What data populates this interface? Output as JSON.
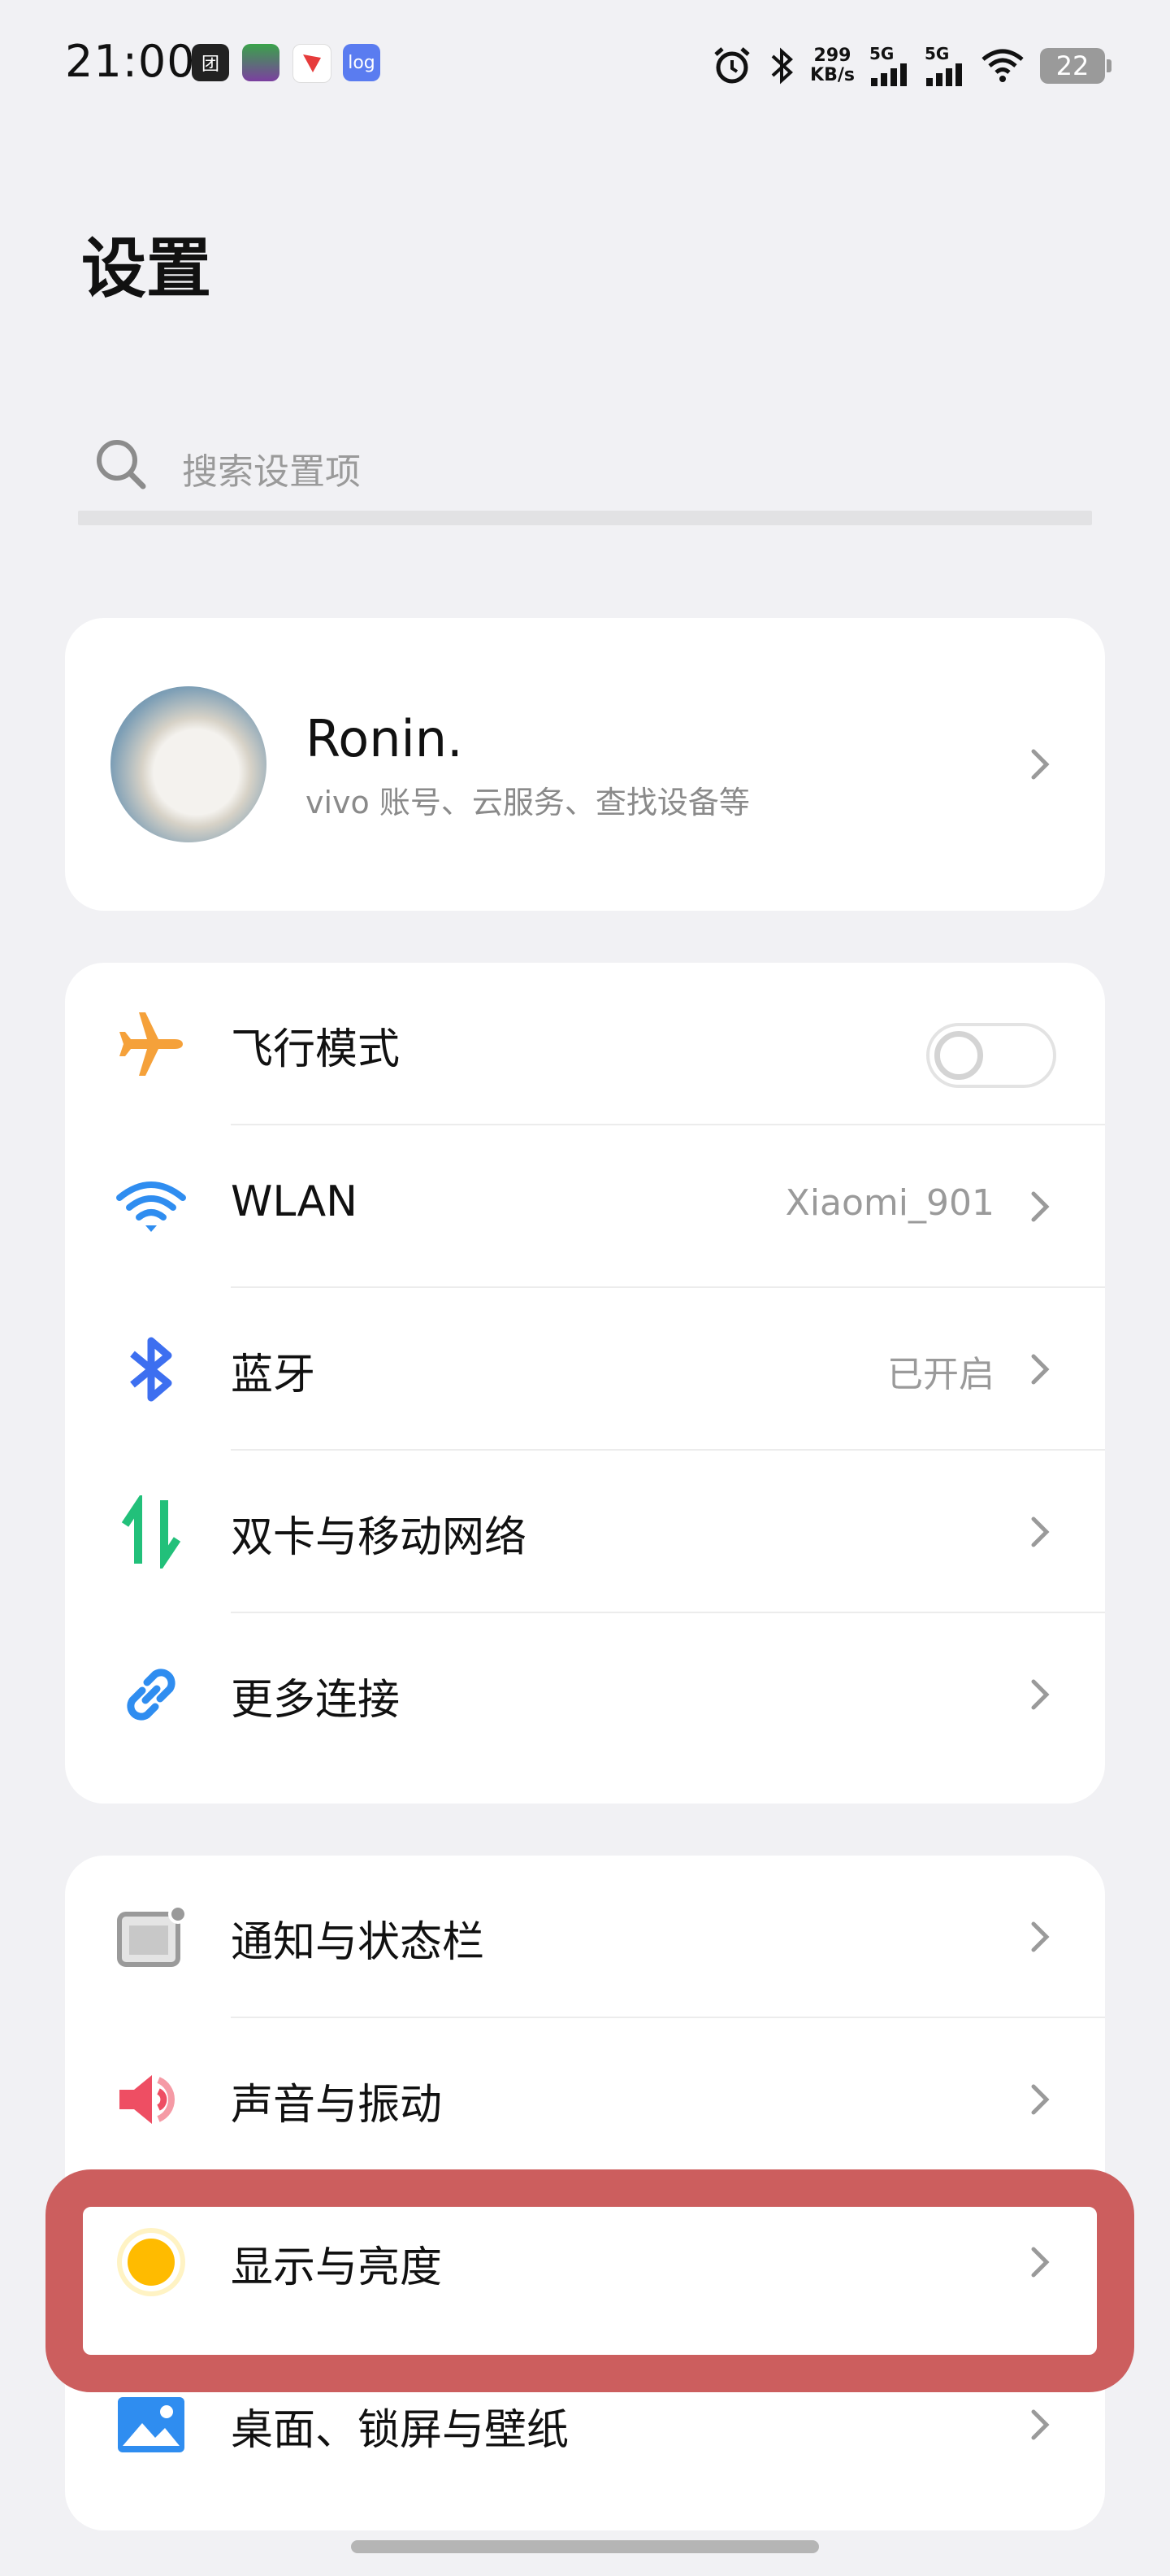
{
  "status_bar": {
    "time": "21:00",
    "apps": [
      "团",
      "",
      "",
      "log"
    ],
    "net_speed_value": "299",
    "net_speed_unit": "KB/s",
    "sim1_label": "5G",
    "sim2_label": "5G",
    "battery": "22",
    "icons": [
      "alarm-icon",
      "bluetooth-icon",
      "signal-icon",
      "wifi-icon",
      "battery-icon"
    ]
  },
  "page": {
    "title": "设置"
  },
  "search": {
    "placeholder": "搜索设置项"
  },
  "profile": {
    "name": "Ronin.",
    "subtitle": "vivo 账号、云服务、查找设备等"
  },
  "connectivity": [
    {
      "label": "飞行模式",
      "value": "",
      "icon": "airplane-icon",
      "toggle_on": false
    },
    {
      "label": "WLAN",
      "value": "Xiaomi_901",
      "icon": "wifi-icon"
    },
    {
      "label": "蓝牙",
      "value": "已开启",
      "icon": "bluetooth-icon"
    },
    {
      "label": "双卡与移动网络",
      "value": "",
      "icon": "mobile-data-icon"
    },
    {
      "label": "更多连接",
      "value": "",
      "icon": "link-icon"
    }
  ],
  "system": [
    {
      "label": "通知与状态栏",
      "icon": "notification-icon"
    },
    {
      "label": "声音与振动",
      "icon": "sound-icon"
    },
    {
      "label": "显示与亮度",
      "icon": "brightness-icon"
    },
    {
      "label": "桌面、锁屏与壁纸",
      "icon": "wallpaper-icon"
    }
  ],
  "colors": {
    "background": "#f1f1f4",
    "highlight": "#cc5e5e",
    "airplane": "#f5a13a",
    "wifi": "#2f8df0",
    "bluetooth": "#3d6ff0",
    "mobile": "#22c07a",
    "link": "#2f8df0",
    "sound": "#ee4e63",
    "brightness": "#ffbb00"
  }
}
